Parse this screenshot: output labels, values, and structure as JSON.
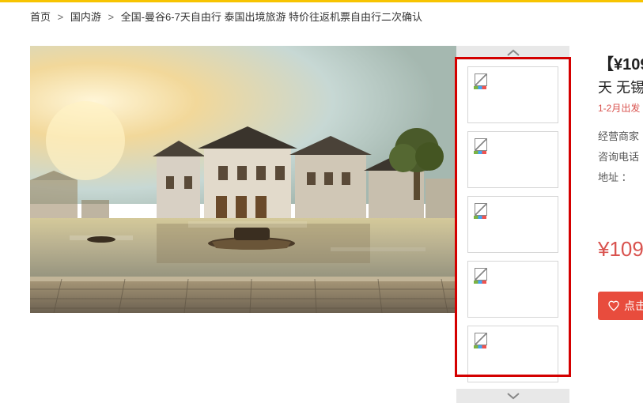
{
  "breadcrumb": {
    "home": "首页",
    "category": "国内游",
    "product": "全国-曼谷6-7天自由行 泰国出境旅游 特价往返机票自由行二次确认",
    "sep": ">"
  },
  "product": {
    "price_title": "【¥109",
    "subtitle_line": "天 无锡",
    "date_info": "1-2月出发",
    "merchant_label": "经营商家",
    "phone_label": "咨询电话",
    "address_label": "地址 ：",
    "big_price": "¥109",
    "heart_button": "点击"
  },
  "thumbs": {
    "count": 5
  },
  "scroll": {
    "up_icon": "chevron-up",
    "down_icon": "chevron-down"
  }
}
